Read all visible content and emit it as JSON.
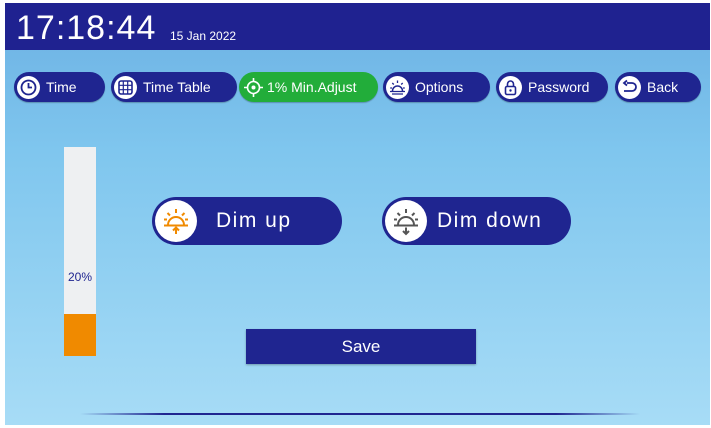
{
  "header": {
    "time": "17:18:44",
    "date": "15 Jan 2022"
  },
  "nav": [
    {
      "label": "Time",
      "icon": "clock-icon"
    },
    {
      "label": "Time Table",
      "icon": "grid-table-icon"
    },
    {
      "label": "1% Min.Adjust",
      "icon": "target-icon",
      "active": true
    },
    {
      "label": "Options",
      "icon": "sun-options-icon"
    },
    {
      "label": "Password",
      "icon": "lock-icon"
    },
    {
      "label": "Back",
      "icon": "back-arrow-icon"
    }
  ],
  "level": {
    "percent_label": "20%",
    "value": 0.2
  },
  "actions": {
    "dim_up": "Dim up",
    "dim_down": "Dim down",
    "save": "Save"
  },
  "colors": {
    "brand": "#1f2590",
    "active": "#22ad3a",
    "accent": "#f08a00"
  }
}
